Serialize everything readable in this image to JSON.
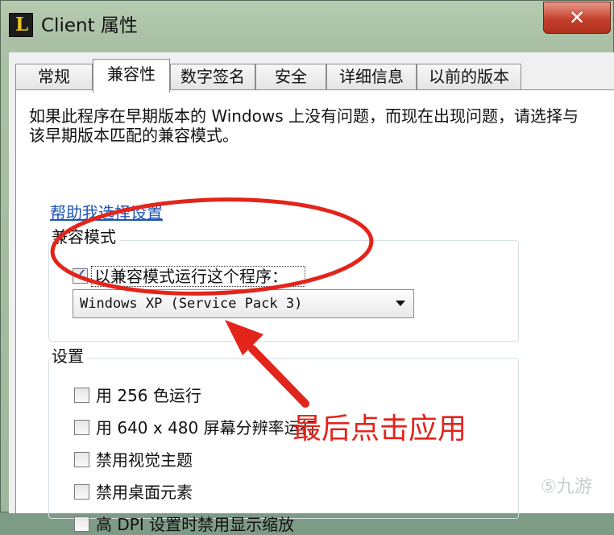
{
  "window": {
    "title": "Client 属性",
    "close_label": "✕"
  },
  "tabs": [
    {
      "label": "常规"
    },
    {
      "label": "兼容性"
    },
    {
      "label": "数字签名"
    },
    {
      "label": "安全"
    },
    {
      "label": "详细信息"
    },
    {
      "label": "以前的版本"
    }
  ],
  "compat": {
    "description": "如果此程序在早期版本的 Windows 上没有问题，而现在出现问题，请选择与该早期版本匹配的兼容模式。",
    "help_link": "帮助我选择设置",
    "mode_group_title": "兼容模式",
    "run_in_compat_mode_label": "以兼容模式运行这个程序：",
    "run_in_compat_mode_checked": true,
    "compat_mode_selected": "Windows XP (Service Pack 3)",
    "settings_group_title": "设置",
    "settings": [
      {
        "label": "用 256 色运行",
        "checked": false
      },
      {
        "label": "用 640 x 480 屏幕分辨率运行",
        "checked": false
      },
      {
        "label": "禁用视觉主题",
        "checked": false
      },
      {
        "label": "禁用桌面元素",
        "checked": false
      },
      {
        "label": "高 DPI 设置时禁用显示缩放",
        "checked": false
      }
    ]
  },
  "annotation": {
    "text": "最后点击应用",
    "color": "#e3241b"
  },
  "watermark": {
    "text": "⑤九游"
  },
  "colors": {
    "link": "#1f55b5",
    "close_button": "#c4402c",
    "checkmark": "#1b3f9a"
  }
}
